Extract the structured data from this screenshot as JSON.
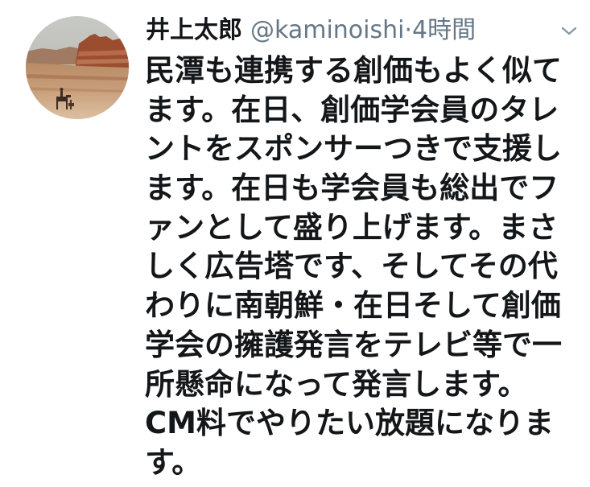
{
  "tweet": {
    "author": {
      "name": "井上太郎",
      "handle": "@kaminoishi",
      "separator": "·",
      "time": "4時間"
    },
    "lines": [
      "民潭も連携する創価もよく似て",
      "ます。在日、創価学会員のタレ",
      "ントをスポンサーつきで支援し",
      "ます。在日も学会員も総出でフ",
      "ァンとして盛り上げます。まさ",
      "しく広告塔です、そしてその代",
      "わりに南朝鮮・在日そして創価",
      "学会の擁護発言をテレビ等で一",
      "所懸命になって発言します。",
      "CM料でやりたい放題になりま",
      "す。"
    ]
  },
  "icons": {
    "menu": "chevron-down-icon"
  },
  "colors": {
    "text": "#14171a",
    "secondary": "#657786",
    "chevron": "#8899a6"
  }
}
